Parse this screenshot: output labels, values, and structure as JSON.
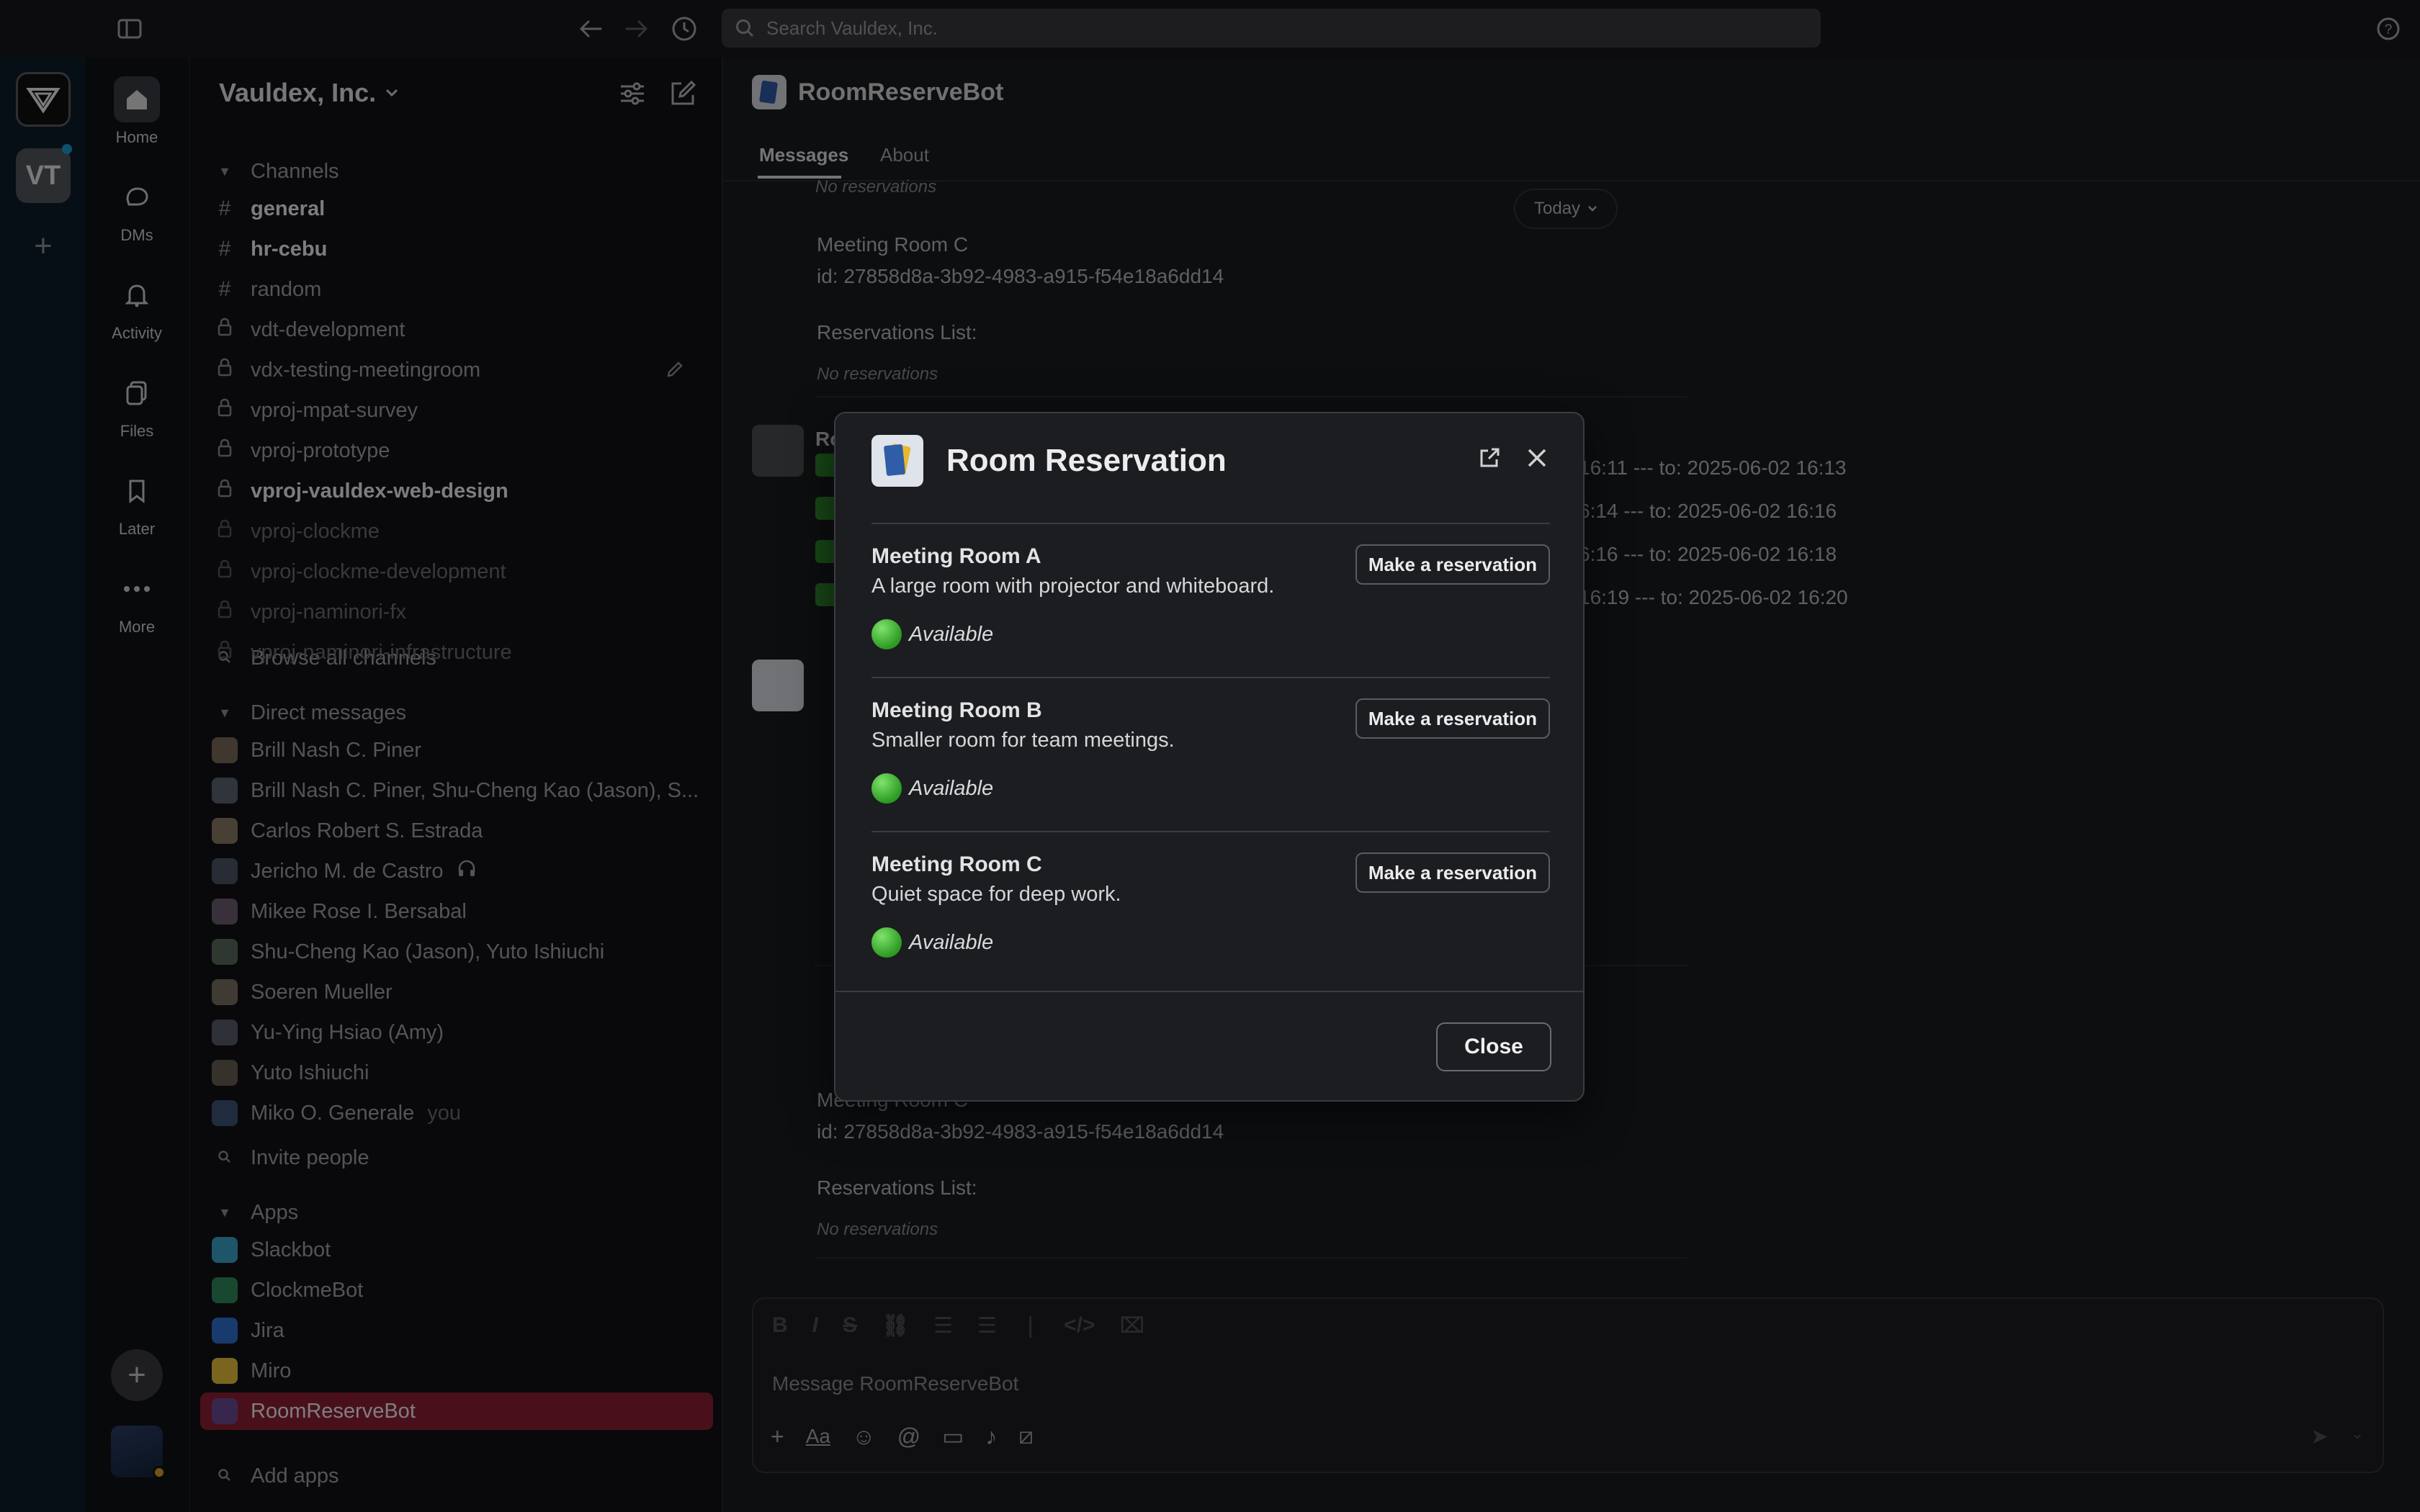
{
  "topbar": {
    "search_placeholder": "Search Vauldex, Inc."
  },
  "rail": {
    "workspace_initials": "VT"
  },
  "nav": [
    {
      "label": "Home",
      "icon": "home-icon"
    },
    {
      "label": "DMs",
      "icon": "dms-icon"
    },
    {
      "label": "Activity",
      "icon": "bell-icon"
    },
    {
      "label": "Files",
      "icon": "files-icon"
    },
    {
      "label": "Later",
      "icon": "bookmark-icon"
    },
    {
      "label": "More",
      "icon": "more-icon"
    }
  ],
  "sidebar": {
    "workspace": "Vauldex, Inc.",
    "channels_header": "Channels",
    "channels": [
      {
        "name": "general",
        "type": "public",
        "unread": true
      },
      {
        "name": "hr-cebu",
        "type": "public",
        "unread": true
      },
      {
        "name": "random",
        "type": "public",
        "unread": false
      },
      {
        "name": "vdt-development",
        "type": "private",
        "unread": false
      },
      {
        "name": "vdx-testing-meetingroom",
        "type": "private",
        "unread": false
      },
      {
        "name": "vproj-mpat-survey",
        "type": "private",
        "unread": false
      },
      {
        "name": "vproj-prototype",
        "type": "private",
        "unread": false
      },
      {
        "name": "vproj-vauldex-web-design",
        "type": "private",
        "unread": true
      },
      {
        "name": "vproj-clockme",
        "type": "private",
        "unread": false,
        "muted": true
      },
      {
        "name": "vproj-clockme-development",
        "type": "private",
        "unread": false,
        "muted": true
      },
      {
        "name": "vproj-naminori-fx",
        "type": "private",
        "unread": false,
        "muted": true
      },
      {
        "name": "vproj-naminori-infrastructure",
        "type": "private",
        "unread": false,
        "muted": true
      }
    ],
    "browse_channels": "Browse all channels",
    "dm_header": "Direct messages",
    "dms": [
      {
        "name": "Brill Nash C. Piner"
      },
      {
        "name": "Brill Nash C. Piner, Shu-Cheng Kao (Jason), S..."
      },
      {
        "name": "Carlos Robert S. Estrada"
      },
      {
        "name": "Jericho M. de Castro"
      },
      {
        "name": "Mikee Rose I. Bersabal"
      },
      {
        "name": "Shu-Cheng Kao (Jason), Yuto Ishiuchi"
      },
      {
        "name": "Soeren Mueller"
      },
      {
        "name": "Yu-Ying Hsiao (Amy)"
      },
      {
        "name": "Yuto Ishiuchi"
      },
      {
        "name": "Miko O. Generale",
        "suffix": "you"
      }
    ],
    "invite": "Invite people",
    "apps_header": "Apps",
    "apps": [
      {
        "name": "Slackbot"
      },
      {
        "name": "ClockmeBot"
      },
      {
        "name": "Jira"
      },
      {
        "name": "Miro"
      },
      {
        "name": "RoomReserveBot",
        "active": true
      }
    ],
    "add_apps": "Add apps"
  },
  "main": {
    "title": "RoomReserveBot",
    "tabs": [
      "Messages",
      "About"
    ],
    "today": "Today",
    "top_no_res": "No reservations",
    "block1": {
      "room": "Meeting Room C",
      "id": "id: 27858d8a-3b92-4983-a915-f54e18a6dd14",
      "list": "Reservations List:",
      "empty": "No reservations"
    },
    "reservation_lines": [
      "16:11 --- to: 2025-06-02 16:13",
      "6:14 --- to: 2025-06-02 16:16",
      "6:16 --- to: 2025-06-02 16:18",
      "16:19 --- to: 2025-06-02 16:20"
    ],
    "block2": {
      "room": "Meeting Room C",
      "id": "id: 27858d8a-3b92-4983-a915-f54e18a6dd14",
      "list": "Reservations List:",
      "empty": "No reservations"
    },
    "composer_placeholder": "Message RoomReserveBot"
  },
  "modal": {
    "title": "Room Reservation",
    "rooms": [
      {
        "name": "Meeting Room A",
        "desc": "A large room with projector and whiteboard.",
        "status": "Available",
        "button": "Make a reservation"
      },
      {
        "name": "Meeting Room B",
        "desc": "Smaller room for team meetings.",
        "status": "Available",
        "button": "Make a reservation"
      },
      {
        "name": "Meeting Room C",
        "desc": "Quiet space for deep work.",
        "status": "Available",
        "button": "Make a reservation"
      }
    ],
    "close": "Close"
  },
  "colors": {
    "active_app": "#8c1f34",
    "available": "#3fbf2b",
    "accent": "#1264a3"
  }
}
